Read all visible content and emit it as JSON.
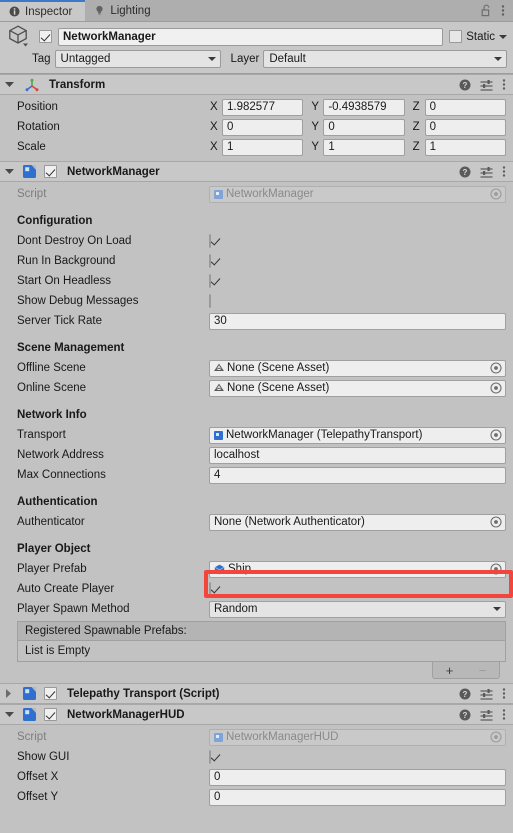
{
  "window": {
    "tabs": [
      {
        "label": "Inspector",
        "icon": "info-icon",
        "active": true
      },
      {
        "label": "Lighting",
        "icon": "lightbulb-icon",
        "active": false
      }
    ],
    "lock_icon": "lock-open-icon",
    "menu_icon": "kebab-menu-icon"
  },
  "gameobject": {
    "icon": "cube-icon",
    "enabled": true,
    "name": "NetworkManager",
    "static_label": "Static",
    "static_checked": false,
    "tag_label": "Tag",
    "tag_value": "Untagged",
    "layer_label": "Layer",
    "layer_value": "Default"
  },
  "transform": {
    "title": "Transform",
    "icon": "transform-gizmo-icon",
    "expanded": true,
    "rows": [
      {
        "label": "Position",
        "x": "1.982577",
        "y": "-0.4938579",
        "z": "0"
      },
      {
        "label": "Rotation",
        "x": "0",
        "y": "0",
        "z": "0"
      },
      {
        "label": "Scale",
        "x": "1",
        "y": "1",
        "z": "1"
      }
    ],
    "axes": [
      "X",
      "Y",
      "Z"
    ]
  },
  "network_manager": {
    "title": "NetworkManager",
    "expanded": true,
    "enabled": true,
    "script_label": "Script",
    "script_value": "NetworkManager",
    "sections": {
      "configuration": {
        "title": "Configuration",
        "fields": [
          {
            "label": "Dont Destroy On Load",
            "type": "checkbox",
            "value": true
          },
          {
            "label": "Run In Background",
            "type": "checkbox",
            "value": true
          },
          {
            "label": "Start On Headless",
            "type": "checkbox",
            "value": true
          },
          {
            "label": "Show Debug Messages",
            "type": "checkbox",
            "value": false
          },
          {
            "label": "Server Tick Rate",
            "type": "text",
            "value": "30"
          }
        ]
      },
      "scene_management": {
        "title": "Scene Management",
        "fields": [
          {
            "label": "Offline Scene",
            "type": "object",
            "value": "None (Scene Asset)",
            "icon": "scene-asset-icon"
          },
          {
            "label": "Online Scene",
            "type": "object",
            "value": "None (Scene Asset)",
            "icon": "scene-asset-icon"
          }
        ]
      },
      "network_info": {
        "title": "Network Info",
        "fields": [
          {
            "label": "Transport",
            "type": "object",
            "value": "NetworkManager (TelepathyTransport)",
            "icon": "script-icon"
          },
          {
            "label": "Network Address",
            "type": "text",
            "value": "localhost"
          },
          {
            "label": "Max Connections",
            "type": "text",
            "value": "4"
          }
        ]
      },
      "authentication": {
        "title": "Authentication",
        "fields": [
          {
            "label": "Authenticator",
            "type": "object",
            "value": "None (Network Authenticator)",
            "icon": "none-icon"
          }
        ]
      },
      "player_object": {
        "title": "Player Object",
        "fields": [
          {
            "label": "Player Prefab",
            "type": "object",
            "value": "Ship",
            "icon": "prefab-cube-icon",
            "highlighted": true
          },
          {
            "label": "Auto Create Player",
            "type": "checkbox",
            "value": true
          },
          {
            "label": "Player Spawn Method",
            "type": "dropdown",
            "value": "Random"
          }
        ]
      }
    },
    "spawnable_list": {
      "header": "Registered Spawnable Prefabs:",
      "empty_text": "List is Empty",
      "add_label": "+",
      "remove_label": "−"
    }
  },
  "telepathy_transport": {
    "title": "Telepathy Transport (Script)",
    "expanded": false,
    "enabled": true
  },
  "network_manager_hud": {
    "title": "NetworkManagerHUD",
    "expanded": true,
    "enabled": true,
    "script_label": "Script",
    "script_value": "NetworkManagerHUD",
    "fields": [
      {
        "label": "Show GUI",
        "type": "checkbox",
        "value": true
      },
      {
        "label": "Offset X",
        "type": "text",
        "value": "0"
      },
      {
        "label": "Offset Y",
        "type": "text",
        "value": "0"
      }
    ]
  },
  "colors": {
    "highlight": "#f4453c",
    "accent_tab": "#3d79c9",
    "prefab_blue": "#2f6fd0",
    "panel_bg": "#c2c2c2",
    "header_bg": "#c8c8c8"
  }
}
